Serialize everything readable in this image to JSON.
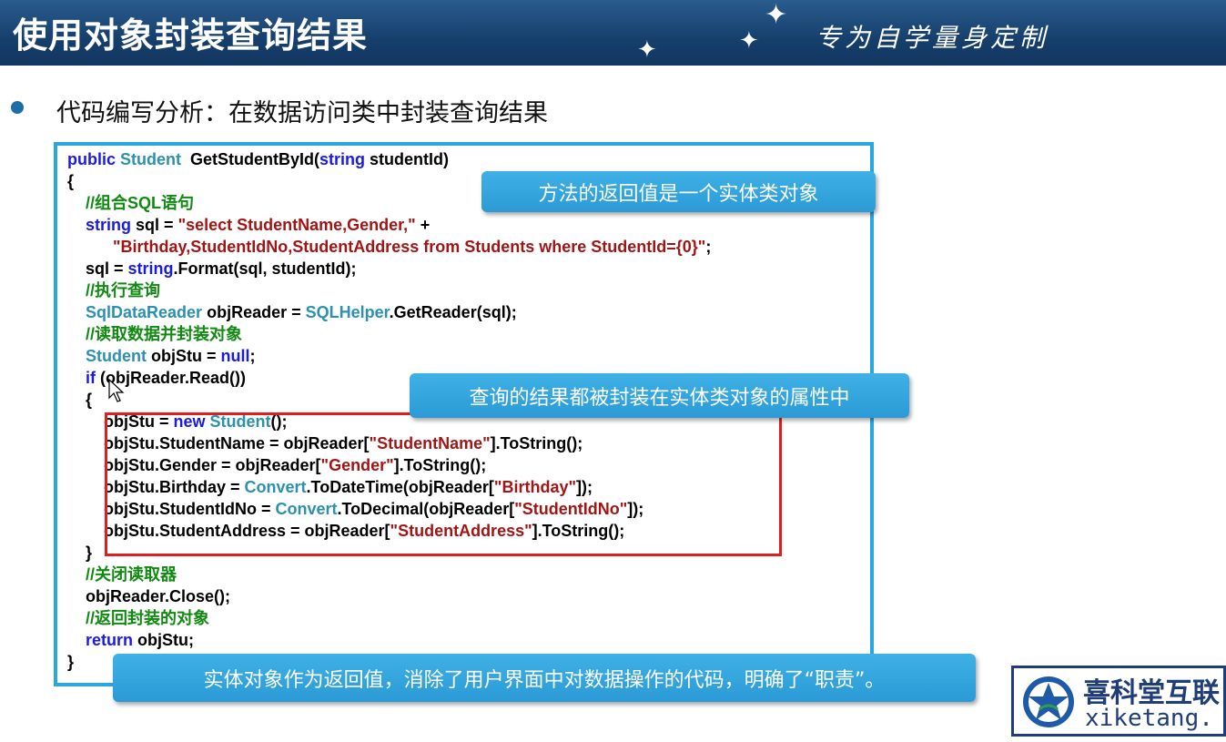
{
  "header": {
    "title": "使用对象封装查询结果",
    "slogan": "专为自学量身定制"
  },
  "bullet": {
    "text": "代码编写分析：在数据访问类中封装查询结果"
  },
  "code": {
    "lines": [
      [
        [
          "kw",
          "public "
        ],
        [
          "ty",
          "Student"
        ],
        [
          "",
          "  GetStudentById("
        ],
        [
          "kw",
          "string"
        ],
        [
          "",
          " studentId)"
        ]
      ],
      [
        [
          "",
          "{"
        ]
      ],
      [
        [
          "",
          "    "
        ],
        [
          "cm",
          "//组合SQL语句"
        ]
      ],
      [
        [
          "",
          "    "
        ],
        [
          "kw",
          "string"
        ],
        [
          "",
          " sql = "
        ],
        [
          "str",
          "\"select StudentName,Gender,\""
        ],
        [
          "",
          " +"
        ]
      ],
      [
        [
          "",
          "          "
        ],
        [
          "str",
          "\"Birthday,StudentIdNo,StudentAddress from Students where StudentId={0}\""
        ],
        [
          "",
          ";"
        ]
      ],
      [
        [
          "",
          "    sql = "
        ],
        [
          "kw",
          "string"
        ],
        [
          "",
          ".Format(sql, studentId);"
        ]
      ],
      [
        [
          "",
          "    "
        ],
        [
          "cm",
          "//执行查询"
        ]
      ],
      [
        [
          "",
          "    "
        ],
        [
          "ty",
          "SqlDataReader"
        ],
        [
          "",
          " objReader = "
        ],
        [
          "ty",
          "SQLHelper"
        ],
        [
          "",
          ".GetReader(sql);"
        ]
      ],
      [
        [
          "",
          "    "
        ],
        [
          "cm",
          "//读取数据并封装对象"
        ]
      ],
      [
        [
          "",
          "    "
        ],
        [
          "ty",
          "Student"
        ],
        [
          "",
          " objStu = "
        ],
        [
          "kw",
          "null"
        ],
        [
          "",
          ";"
        ]
      ],
      [
        [
          "",
          "    "
        ],
        [
          "kw",
          "if"
        ],
        [
          "",
          " (objReader.Read())"
        ]
      ],
      [
        [
          "",
          "    {"
        ]
      ],
      [
        [
          "",
          "        objStu = "
        ],
        [
          "kw",
          "new"
        ],
        [
          "",
          " "
        ],
        [
          "ty",
          "Student"
        ],
        [
          "",
          "();"
        ]
      ],
      [
        [
          "",
          "        objStu.StudentName = objReader["
        ],
        [
          "str",
          "\"StudentName\""
        ],
        [
          "",
          "].ToString();"
        ]
      ],
      [
        [
          "",
          "        objStu.Gender = objReader["
        ],
        [
          "str",
          "\"Gender\""
        ],
        [
          "",
          "].ToString();"
        ]
      ],
      [
        [
          "",
          "        objStu.Birthday = "
        ],
        [
          "ty",
          "Convert"
        ],
        [
          "",
          ".ToDateTime(objReader["
        ],
        [
          "str",
          "\"Birthday\""
        ],
        [
          "",
          "]);"
        ]
      ],
      [
        [
          "",
          "        objStu.StudentIdNo = "
        ],
        [
          "ty",
          "Convert"
        ],
        [
          "",
          ".ToDecimal(objReader["
        ],
        [
          "str",
          "\"StudentIdNo\""
        ],
        [
          "",
          "]);"
        ]
      ],
      [
        [
          "",
          "        objStu.StudentAddress = objReader["
        ],
        [
          "str",
          "\"StudentAddress\""
        ],
        [
          "",
          "].ToString();"
        ]
      ],
      [
        [
          "",
          "    }"
        ]
      ],
      [
        [
          "",
          "    "
        ],
        [
          "cm",
          "//关闭读取器"
        ]
      ],
      [
        [
          "",
          "    objReader.Close();"
        ]
      ],
      [
        [
          "",
          "    "
        ],
        [
          "cm",
          "//返回封装的对象"
        ]
      ],
      [
        [
          "",
          "    "
        ],
        [
          "kw",
          "return"
        ],
        [
          "",
          " objStu;"
        ]
      ],
      [
        [
          "",
          "}"
        ]
      ]
    ]
  },
  "callouts": {
    "return_value": "方法的返回值是一个实体类对象",
    "encapsulated": "查询的结果都被封装在实体类对象的属性中",
    "summary": "实体对象作为返回值，消除了用户界面中对数据操作的代码，明确了“职责”。"
  },
  "logo": {
    "name_cn": "喜科堂互联",
    "name_en": "xiketang."
  },
  "colors": {
    "header_bg": "#163f6c",
    "frame": "#29a8e0",
    "keyword": "#1a1ae6",
    "type": "#2b91af",
    "string": "#a31515",
    "comment": "#118a11",
    "highlight_box": "#e01e1e",
    "callout_bg": "#2b9ad6"
  }
}
